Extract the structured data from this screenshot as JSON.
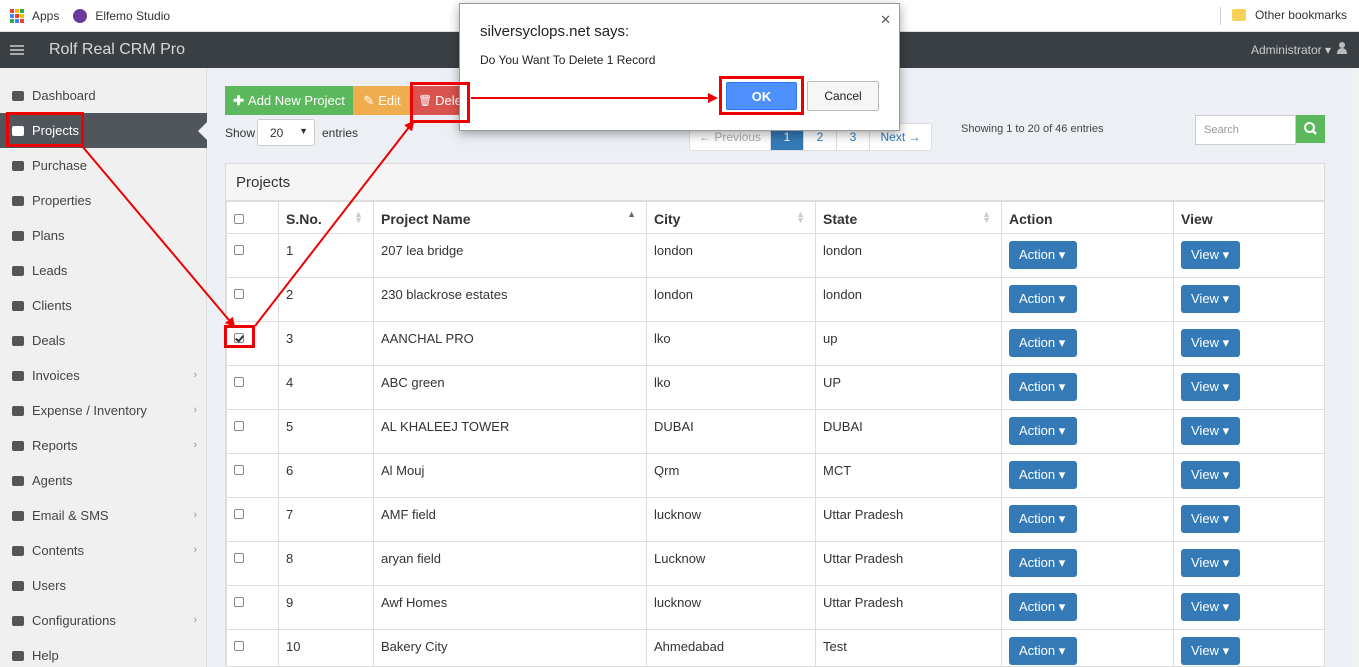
{
  "bookmarks": {
    "apps": "Apps",
    "elfemo": "Elfemo Studio",
    "other": "Other bookmarks"
  },
  "header": {
    "brand": "Rolf Real CRM Pro",
    "user": "Administrator"
  },
  "sidebar": {
    "items": [
      {
        "label": "Dashboard",
        "icon": "dashboard-icon",
        "has_submenu": false
      },
      {
        "label": "Projects",
        "icon": "projects-icon",
        "has_submenu": false,
        "active": true
      },
      {
        "label": "Purchase",
        "icon": "cart-icon",
        "has_submenu": false
      },
      {
        "label": "Properties",
        "icon": "building-icon",
        "has_submenu": false
      },
      {
        "label": "Plans",
        "icon": "briefcase-icon",
        "has_submenu": false
      },
      {
        "label": "Leads",
        "icon": "rocket-icon",
        "has_submenu": false
      },
      {
        "label": "Clients",
        "icon": "users-icon",
        "has_submenu": false
      },
      {
        "label": "Deals",
        "icon": "thumbs-up-icon",
        "has_submenu": false
      },
      {
        "label": "Invoices",
        "icon": "pin-icon",
        "has_submenu": true
      },
      {
        "label": "Expense / Inventory",
        "icon": "cart-icon",
        "has_submenu": true
      },
      {
        "label": "Reports",
        "icon": "table-icon",
        "has_submenu": true
      },
      {
        "label": "Agents",
        "icon": "lock-icon",
        "has_submenu": false
      },
      {
        "label": "Email & SMS",
        "icon": "shield-icon",
        "has_submenu": true
      },
      {
        "label": "Contents",
        "icon": "list-icon",
        "has_submenu": true
      },
      {
        "label": "Users",
        "icon": "user-icon",
        "has_submenu": false
      },
      {
        "label": "Configurations",
        "icon": "gears-icon",
        "has_submenu": true
      },
      {
        "label": "Help",
        "icon": "help-icon",
        "has_submenu": false
      }
    ]
  },
  "toolbar": {
    "add": "Add New Project",
    "edit": "Edit",
    "delete": "Dele"
  },
  "length": {
    "show": "Show",
    "value": "20",
    "entries": "entries"
  },
  "pager": {
    "prev": "← Previous",
    "p1": "1",
    "p2": "2",
    "p3": "3",
    "next": "Next →"
  },
  "info": "Showing 1 to 20 of 46 entries",
  "search": {
    "placeholder": "Search"
  },
  "panel": {
    "title": "Projects"
  },
  "table": {
    "columns": [
      "S.No.",
      "Project Name",
      "City",
      "State",
      "Action",
      "View"
    ],
    "rows": [
      {
        "sno": "1",
        "name": "207 lea bridge",
        "city": "london",
        "state": "london",
        "checked": false
      },
      {
        "sno": "2",
        "name": "230 blackrose estates",
        "city": "london",
        "state": "london",
        "checked": false
      },
      {
        "sno": "3",
        "name": "AANCHAL PRO",
        "city": "lko",
        "state": "up",
        "checked": true
      },
      {
        "sno": "4",
        "name": "ABC green",
        "city": "lko",
        "state": "UP",
        "checked": false
      },
      {
        "sno": "5",
        "name": "AL KHALEEJ TOWER",
        "city": "DUBAI",
        "state": "DUBAI",
        "checked": false
      },
      {
        "sno": "6",
        "name": "Al Mouj",
        "city": "Qrm",
        "state": "MCT",
        "checked": false
      },
      {
        "sno": "7",
        "name": "AMF field",
        "city": "lucknow",
        "state": "Uttar Pradesh",
        "checked": false
      },
      {
        "sno": "8",
        "name": "aryan field",
        "city": "Lucknow",
        "state": "Uttar Pradesh",
        "checked": false
      },
      {
        "sno": "9",
        "name": "Awf Homes",
        "city": "lucknow",
        "state": "Uttar Pradesh",
        "checked": false
      },
      {
        "sno": "10",
        "name": "Bakery City",
        "city": "Ahmedabad",
        "state": "Test",
        "checked": false
      }
    ],
    "action_label": "Action",
    "view_label": "View"
  },
  "dialog": {
    "title": "silversyclops.net says:",
    "message": "Do You Want To Delete 1 Record",
    "ok": "OK",
    "cancel": "Cancel"
  },
  "colors": {
    "annotation": "#ee0000",
    "primary": "#337ab7",
    "success": "#5cb85c",
    "warning": "#f0ad4e",
    "danger": "#d9534f"
  }
}
